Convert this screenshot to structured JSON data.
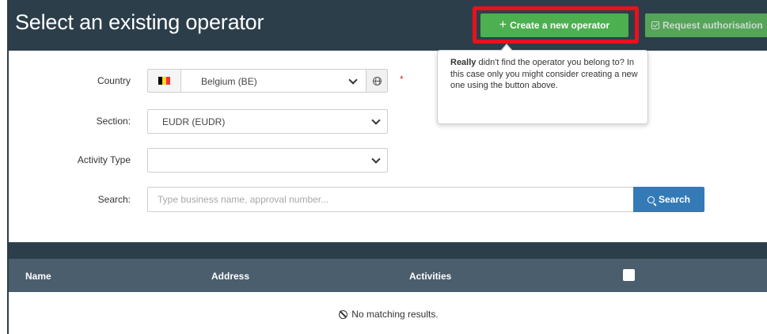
{
  "header": {
    "title": "Select an existing operator",
    "create_button": {
      "icon": "plus-icon",
      "label": "Create a new operator"
    },
    "request_button": {
      "icon": "check-square-icon",
      "label": "Request authorisation"
    }
  },
  "tooltip": {
    "bold": "Really",
    "text": " didn't find the operator you belong to? In this case only you might consider creating a new one using the button above."
  },
  "form": {
    "country": {
      "label": "Country",
      "value": "Belgium (BE)",
      "flag_colors": [
        "#000000",
        "#fdda24",
        "#ef3340"
      ],
      "required_mark": "*"
    },
    "section": {
      "label": "Section:",
      "value": "EUDR (EUDR)"
    },
    "activity_type": {
      "label": "Activity Type",
      "value": ""
    },
    "search": {
      "label": "Search:",
      "placeholder": "Type business name, approval number...",
      "button_label": "Search"
    }
  },
  "table": {
    "columns": [
      "Name",
      "Address",
      "Activities"
    ],
    "empty_message": "No matching results."
  },
  "colors": {
    "header_bg": "#2d3e4b",
    "create_button": "#4caf50",
    "highlight_border": "#e8121c",
    "search_button": "#337ab7",
    "table_header_bg": "#4a5e6d"
  }
}
